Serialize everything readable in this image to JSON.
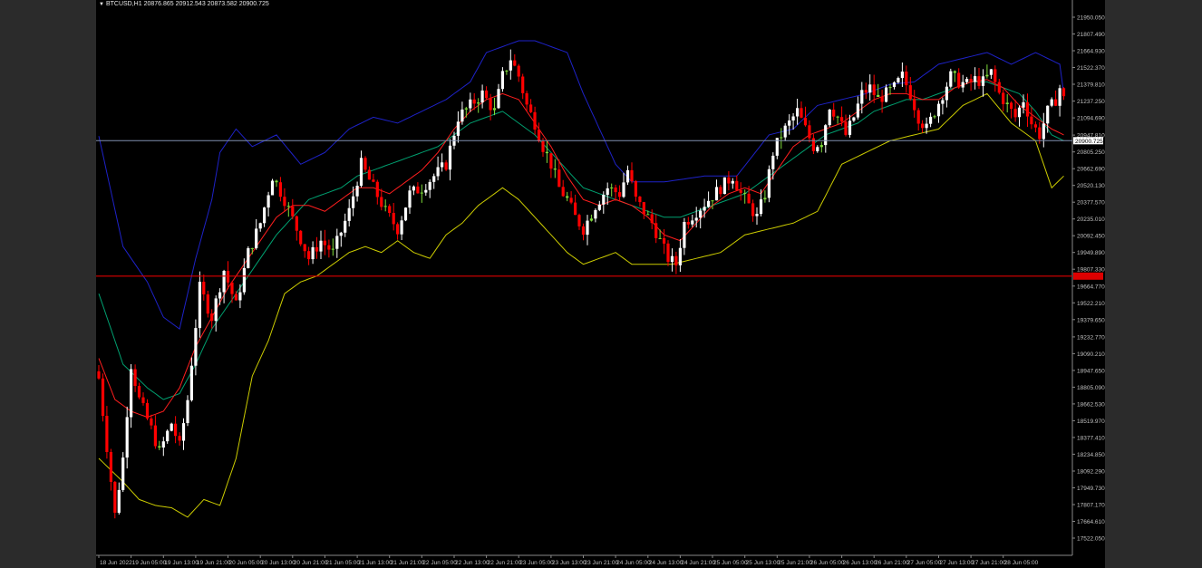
{
  "header": {
    "symbol": "BTCUSD,H1",
    "ohlc": "20876.865 20912.543 20873.582 20900.725",
    "menu_icon": "triangle-down-icon"
  },
  "colors": {
    "background": "#000000",
    "bull_candle": "#ffffff",
    "bull_doji": "#7fdc3a",
    "bear_candle": "#ff0000",
    "upper_band": "#1e22c8",
    "lower_band": "#cccc00",
    "middle_band": "#00a070",
    "moving_average": "#ff1e1e",
    "price_line": "#8090b0",
    "support_line": "#dd0000",
    "axis_text": "#c0c0c0"
  },
  "chart_data": {
    "type": "candlestick",
    "title": "",
    "xlabel": "",
    "ylabel": "",
    "ylim": [
      17522.05,
      21950.05
    ],
    "y_ticks": [
      21950.05,
      21807.49,
      21664.93,
      21522.37,
      21379.81,
      21237.25,
      21094.69,
      20947.81,
      20805.25,
      20662.69,
      20520.13,
      20377.57,
      20235.01,
      20092.45,
      19949.89,
      19807.33,
      19664.77,
      19522.21,
      19379.65,
      19232.77,
      19090.21,
      18947.65,
      18805.09,
      18662.53,
      18519.97,
      18377.41,
      18234.85,
      18092.29,
      17949.73,
      17807.17,
      17664.61,
      17522.05
    ],
    "y_tick_labels": [
      "21950.050",
      "21807.490",
      "21664.930",
      "21522.370",
      "21379.810",
      "21237.250",
      "21094.690",
      "20947.810",
      "20805.250",
      "20662.690",
      "20520.130",
      "20377.570",
      "20235.010",
      "20092.450",
      "19949.890",
      "19807.330",
      "19664.770",
      "19522.210",
      "19379.650",
      "19232.770",
      "19090.210",
      "18947.650",
      "18805.090",
      "18662.530",
      "18519.970",
      "18377.410",
      "18234.850",
      "18092.290",
      "17949.730",
      "17807.170",
      "17664.610",
      "17522.050"
    ],
    "x_labels": [
      "18 Jun 2022",
      "19 Jun 05:00",
      "19 Jun 13:00",
      "19 Jun 21:00",
      "20 Jun 05:00",
      "20 Jun 13:00",
      "20 Jun 21:00",
      "21 Jun 05:00",
      "21 Jun 13:00",
      "21 Jun 21:00",
      "22 Jun 05:00",
      "22 Jun 13:00",
      "22 Jun 21:00",
      "23 Jun 05:00",
      "23 Jun 13:00",
      "23 Jun 21:00",
      "24 Jun 05:00",
      "24 Jun 13:00",
      "24 Jun 21:00",
      "25 Jun 05:00",
      "25 Jun 13:00",
      "25 Jun 21:00",
      "26 Jun 05:00",
      "26 Jun 13:00",
      "26 Jun 21:00",
      "27 Jun 05:00",
      "27 Jun 13:00",
      "27 Jun 21:00",
      "28 Jun 05:00"
    ],
    "bar_count": 240,
    "current_price": 20900.725,
    "current_price_label": "20900.725",
    "support_level": 19749.5,
    "close_path": [
      [
        0,
        18880
      ],
      [
        4,
        17720
      ],
      [
        6,
        18200
      ],
      [
        8,
        19000
      ],
      [
        10,
        18700
      ],
      [
        13,
        18450
      ],
      [
        15,
        18250
      ],
      [
        18,
        18500
      ],
      [
        20,
        18300
      ],
      [
        22,
        18700
      ],
      [
        25,
        19650
      ],
      [
        28,
        19400
      ],
      [
        31,
        19800
      ],
      [
        34,
        19500
      ],
      [
        37,
        19950
      ],
      [
        40,
        20200
      ],
      [
        43,
        20600
      ],
      [
        46,
        20400
      ],
      [
        49,
        20150
      ],
      [
        52,
        19900
      ],
      [
        55,
        20050
      ],
      [
        58,
        19950
      ],
      [
        62,
        20300
      ],
      [
        65,
        20700
      ],
      [
        68,
        20500
      ],
      [
        71,
        20300
      ],
      [
        74,
        20150
      ],
      [
        77,
        20450
      ],
      [
        80,
        20500
      ],
      [
        83,
        20600
      ],
      [
        86,
        20700
      ],
      [
        89,
        21100
      ],
      [
        92,
        21200
      ],
      [
        95,
        21300
      ],
      [
        98,
        21150
      ],
      [
        100,
        21450
      ],
      [
        102,
        21600
      ],
      [
        104,
        21450
      ],
      [
        106,
        21200
      ],
      [
        108,
        21050
      ],
      [
        110,
        20850
      ],
      [
        112,
        20700
      ],
      [
        114,
        20500
      ],
      [
        116,
        20400
      ],
      [
        118,
        20250
      ],
      [
        120,
        20150
      ],
      [
        123,
        20350
      ],
      [
        126,
        20500
      ],
      [
        129,
        20450
      ],
      [
        131,
        20650
      ],
      [
        133,
        20400
      ],
      [
        135,
        20300
      ],
      [
        137,
        20200
      ],
      [
        139,
        20050
      ],
      [
        141,
        19900
      ],
      [
        143,
        19850
      ],
      [
        145,
        20200
      ],
      [
        148,
        20300
      ],
      [
        151,
        20400
      ],
      [
        154,
        20500
      ],
      [
        157,
        20600
      ],
      [
        159,
        20450
      ],
      [
        161,
        20350
      ],
      [
        163,
        20250
      ],
      [
        165,
        20450
      ],
      [
        167,
        20800
      ],
      [
        169,
        20950
      ],
      [
        171,
        21050
      ],
      [
        173,
        21150
      ],
      [
        175,
        21000
      ],
      [
        177,
        20850
      ],
      [
        179,
        20900
      ],
      [
        181,
        21200
      ],
      [
        183,
        21100
      ],
      [
        185,
        20950
      ],
      [
        187,
        21100
      ],
      [
        189,
        21300
      ],
      [
        191,
        21350
      ],
      [
        193,
        21250
      ],
      [
        195,
        21300
      ],
      [
        197,
        21350
      ],
      [
        199,
        21450
      ],
      [
        201,
        21300
      ],
      [
        203,
        21100
      ],
      [
        205,
        21000
      ],
      [
        207,
        21150
      ],
      [
        209,
        21300
      ],
      [
        211,
        21450
      ],
      [
        213,
        21400
      ],
      [
        215,
        21380
      ],
      [
        217,
        21420
      ],
      [
        219,
        21400
      ],
      [
        221,
        21480
      ],
      [
        223,
        21300
      ],
      [
        225,
        21200
      ],
      [
        227,
        21100
      ],
      [
        229,
        21250
      ],
      [
        231,
        21050
      ],
      [
        233,
        20950
      ],
      [
        235,
        21150
      ],
      [
        237,
        21250
      ],
      [
        238,
        21350
      ],
      [
        239,
        21250
      ]
    ],
    "indicators": {
      "upper_band_path": [
        [
          0,
          20940
        ],
        [
          6,
          20000
        ],
        [
          12,
          19700
        ],
        [
          16,
          19400
        ],
        [
          20,
          19300
        ],
        [
          24,
          19900
        ],
        [
          28,
          20400
        ],
        [
          30,
          20800
        ],
        [
          34,
          21000
        ],
        [
          38,
          20850
        ],
        [
          44,
          20950
        ],
        [
          50,
          20700
        ],
        [
          56,
          20800
        ],
        [
          62,
          21000
        ],
        [
          68,
          21100
        ],
        [
          74,
          21050
        ],
        [
          80,
          21150
        ],
        [
          86,
          21250
        ],
        [
          92,
          21400
        ],
        [
          96,
          21650
        ],
        [
          100,
          21700
        ],
        [
          104,
          21750
        ],
        [
          108,
          21750
        ],
        [
          112,
          21700
        ],
        [
          116,
          21650
        ],
        [
          120,
          21300
        ],
        [
          124,
          21000
        ],
        [
          128,
          20700
        ],
        [
          132,
          20550
        ],
        [
          140,
          20550
        ],
        [
          150,
          20600
        ],
        [
          158,
          20600
        ],
        [
          166,
          20950
        ],
        [
          172,
          21000
        ],
        [
          178,
          21200
        ],
        [
          184,
          21250
        ],
        [
          190,
          21300
        ],
        [
          196,
          21380
        ],
        [
          202,
          21400
        ],
        [
          208,
          21550
        ],
        [
          214,
          21600
        ],
        [
          220,
          21650
        ],
        [
          226,
          21550
        ],
        [
          232,
          21650
        ],
        [
          238,
          21550
        ],
        [
          239,
          21300
        ]
      ],
      "lower_band_path": [
        [
          0,
          18200
        ],
        [
          6,
          18000
        ],
        [
          10,
          17850
        ],
        [
          14,
          17800
        ],
        [
          18,
          17780
        ],
        [
          22,
          17700
        ],
        [
          26,
          17850
        ],
        [
          30,
          17800
        ],
        [
          34,
          18200
        ],
        [
          38,
          18900
        ],
        [
          42,
          19200
        ],
        [
          46,
          19600
        ],
        [
          50,
          19700
        ],
        [
          54,
          19750
        ],
        [
          58,
          19850
        ],
        [
          62,
          19950
        ],
        [
          66,
          20000
        ],
        [
          70,
          19950
        ],
        [
          74,
          20050
        ],
        [
          78,
          19950
        ],
        [
          82,
          19900
        ],
        [
          86,
          20100
        ],
        [
          90,
          20200
        ],
        [
          94,
          20350
        ],
        [
          98,
          20450
        ],
        [
          100,
          20500
        ],
        [
          104,
          20400
        ],
        [
          108,
          20250
        ],
        [
          112,
          20100
        ],
        [
          116,
          19950
        ],
        [
          120,
          19850
        ],
        [
          124,
          19900
        ],
        [
          128,
          19950
        ],
        [
          132,
          19850
        ],
        [
          136,
          19850
        ],
        [
          142,
          19850
        ],
        [
          148,
          19900
        ],
        [
          154,
          19950
        ],
        [
          160,
          20100
        ],
        [
          166,
          20150
        ],
        [
          172,
          20200
        ],
        [
          178,
          20300
        ],
        [
          184,
          20700
        ],
        [
          190,
          20800
        ],
        [
          196,
          20900
        ],
        [
          202,
          20950
        ],
        [
          208,
          21000
        ],
        [
          214,
          21200
        ],
        [
          220,
          21300
        ],
        [
          226,
          21050
        ],
        [
          232,
          20900
        ],
        [
          236,
          20500
        ],
        [
          239,
          20600
        ]
      ],
      "middle_band_path": [
        [
          0,
          19600
        ],
        [
          6,
          19000
        ],
        [
          12,
          18800
        ],
        [
          16,
          18700
        ],
        [
          20,
          18750
        ],
        [
          24,
          19000
        ],
        [
          28,
          19300
        ],
        [
          32,
          19500
        ],
        [
          36,
          19700
        ],
        [
          40,
          19900
        ],
        [
          44,
          20100
        ],
        [
          48,
          20250
        ],
        [
          52,
          20400
        ],
        [
          56,
          20450
        ],
        [
          60,
          20500
        ],
        [
          64,
          20600
        ],
        [
          68,
          20650
        ],
        [
          72,
          20700
        ],
        [
          76,
          20750
        ],
        [
          80,
          20800
        ],
        [
          84,
          20850
        ],
        [
          88,
          20950
        ],
        [
          92,
          21050
        ],
        [
          96,
          21100
        ],
        [
          100,
          21150
        ],
        [
          104,
          21050
        ],
        [
          108,
          20950
        ],
        [
          112,
          20800
        ],
        [
          116,
          20650
        ],
        [
          120,
          20500
        ],
        [
          124,
          20450
        ],
        [
          128,
          20400
        ],
        [
          132,
          20350
        ],
        [
          136,
          20300
        ],
        [
          140,
          20250
        ],
        [
          144,
          20250
        ],
        [
          148,
          20300
        ],
        [
          152,
          20350
        ],
        [
          156,
          20400
        ],
        [
          160,
          20450
        ],
        [
          164,
          20550
        ],
        [
          168,
          20650
        ],
        [
          172,
          20750
        ],
        [
          176,
          20850
        ],
        [
          180,
          20950
        ],
        [
          184,
          21000
        ],
        [
          188,
          21050
        ],
        [
          192,
          21150
        ],
        [
          196,
          21200
        ],
        [
          200,
          21250
        ],
        [
          204,
          21250
        ],
        [
          208,
          21300
        ],
        [
          212,
          21350
        ],
        [
          216,
          21400
        ],
        [
          220,
          21400
        ],
        [
          224,
          21350
        ],
        [
          228,
          21300
        ],
        [
          232,
          21150
        ],
        [
          236,
          20950
        ],
        [
          239,
          20900
        ]
      ],
      "moving_average_path": [
        [
          0,
          19050
        ],
        [
          4,
          18700
        ],
        [
          8,
          18600
        ],
        [
          12,
          18550
        ],
        [
          16,
          18600
        ],
        [
          20,
          18800
        ],
        [
          24,
          19150
        ],
        [
          28,
          19400
        ],
        [
          32,
          19650
        ],
        [
          36,
          19850
        ],
        [
          40,
          20050
        ],
        [
          44,
          20250
        ],
        [
          48,
          20350
        ],
        [
          52,
          20350
        ],
        [
          56,
          20300
        ],
        [
          60,
          20400
        ],
        [
          64,
          20500
        ],
        [
          68,
          20500
        ],
        [
          72,
          20450
        ],
        [
          76,
          20550
        ],
        [
          80,
          20650
        ],
        [
          84,
          20800
        ],
        [
          88,
          21000
        ],
        [
          92,
          21150
        ],
        [
          96,
          21250
        ],
        [
          100,
          21300
        ],
        [
          104,
          21250
        ],
        [
          108,
          21050
        ],
        [
          112,
          20850
        ],
        [
          116,
          20600
        ],
        [
          120,
          20400
        ],
        [
          124,
          20350
        ],
        [
          128,
          20400
        ],
        [
          132,
          20350
        ],
        [
          136,
          20250
        ],
        [
          140,
          20100
        ],
        [
          144,
          20050
        ],
        [
          148,
          20200
        ],
        [
          152,
          20350
        ],
        [
          156,
          20450
        ],
        [
          160,
          20500
        ],
        [
          164,
          20450
        ],
        [
          168,
          20650
        ],
        [
          172,
          20850
        ],
        [
          176,
          20950
        ],
        [
          180,
          21000
        ],
        [
          184,
          21050
        ],
        [
          188,
          21150
        ],
        [
          192,
          21250
        ],
        [
          196,
          21300
        ],
        [
          200,
          21300
        ],
        [
          204,
          21250
        ],
        [
          208,
          21250
        ],
        [
          212,
          21350
        ],
        [
          216,
          21400
        ],
        [
          220,
          21420
        ],
        [
          224,
          21350
        ],
        [
          228,
          21200
        ],
        [
          232,
          21100
        ],
        [
          236,
          21000
        ],
        [
          239,
          20950
        ]
      ]
    }
  }
}
